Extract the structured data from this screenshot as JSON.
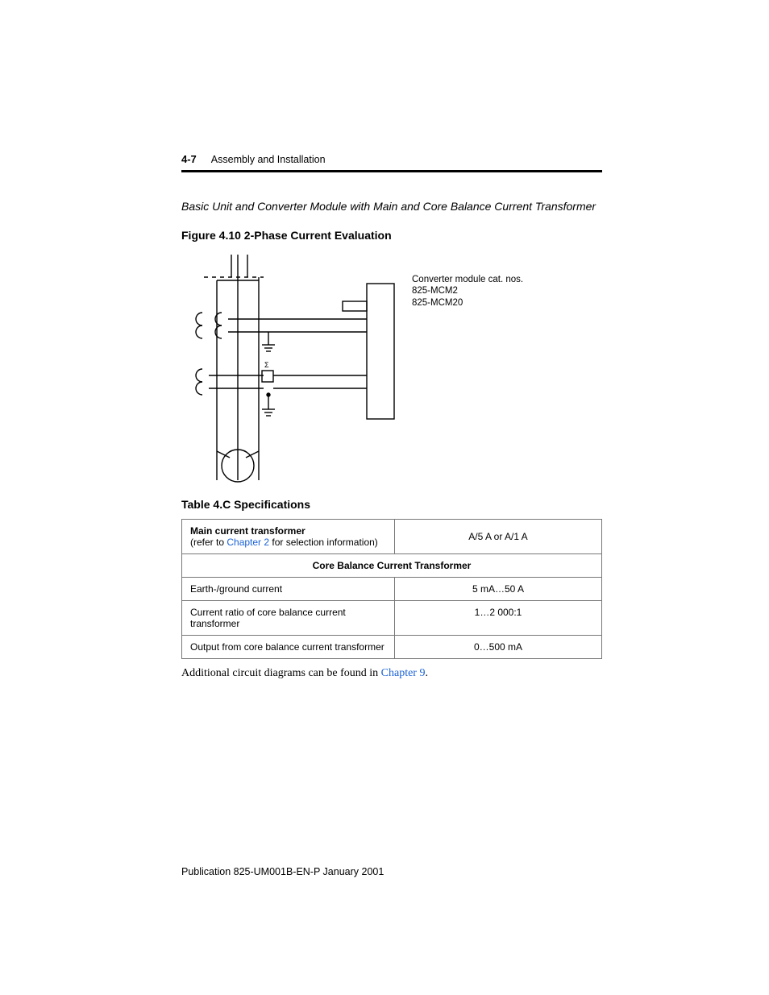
{
  "header": {
    "page_number": "4-7",
    "section_title": "Assembly and Installation"
  },
  "subtitle": "Basic Unit and Converter Module with Main and Core Balance Current Transformer",
  "figure": {
    "caption": "Figure 4.10 2-Phase Current Evaluation",
    "sigma_label": "Σ",
    "module_note_line1": "Converter module cat. nos.",
    "module_note_line2": "825-MCM2",
    "module_note_line3": "825-MCM20"
  },
  "table": {
    "caption": "Table 4.C Specifications",
    "row1_label_strong": "Main current transformer",
    "row1_label_paren_prefix": "(refer to ",
    "row1_label_link": "Chapter 2",
    "row1_label_paren_suffix": " for selection information)",
    "row1_value": "A/5 A or A/1 A",
    "core_balance_header": "Core Balance Current Transformer",
    "row2_label": "Earth-/ground current",
    "row2_value": "5 mA…50 A",
    "row3_label": "Current ratio of core balance current transformer",
    "row3_value": "1…2 000:1",
    "row4_label": "Output from core balance current transformer",
    "row4_value": "0…500 mA"
  },
  "below_table_prefix": "Additional circuit diagrams can be found in ",
  "below_table_link": "Chapter 9",
  "below_table_suffix": ".",
  "publication_line": "Publication 825-UM001B-EN-P   January 2001"
}
